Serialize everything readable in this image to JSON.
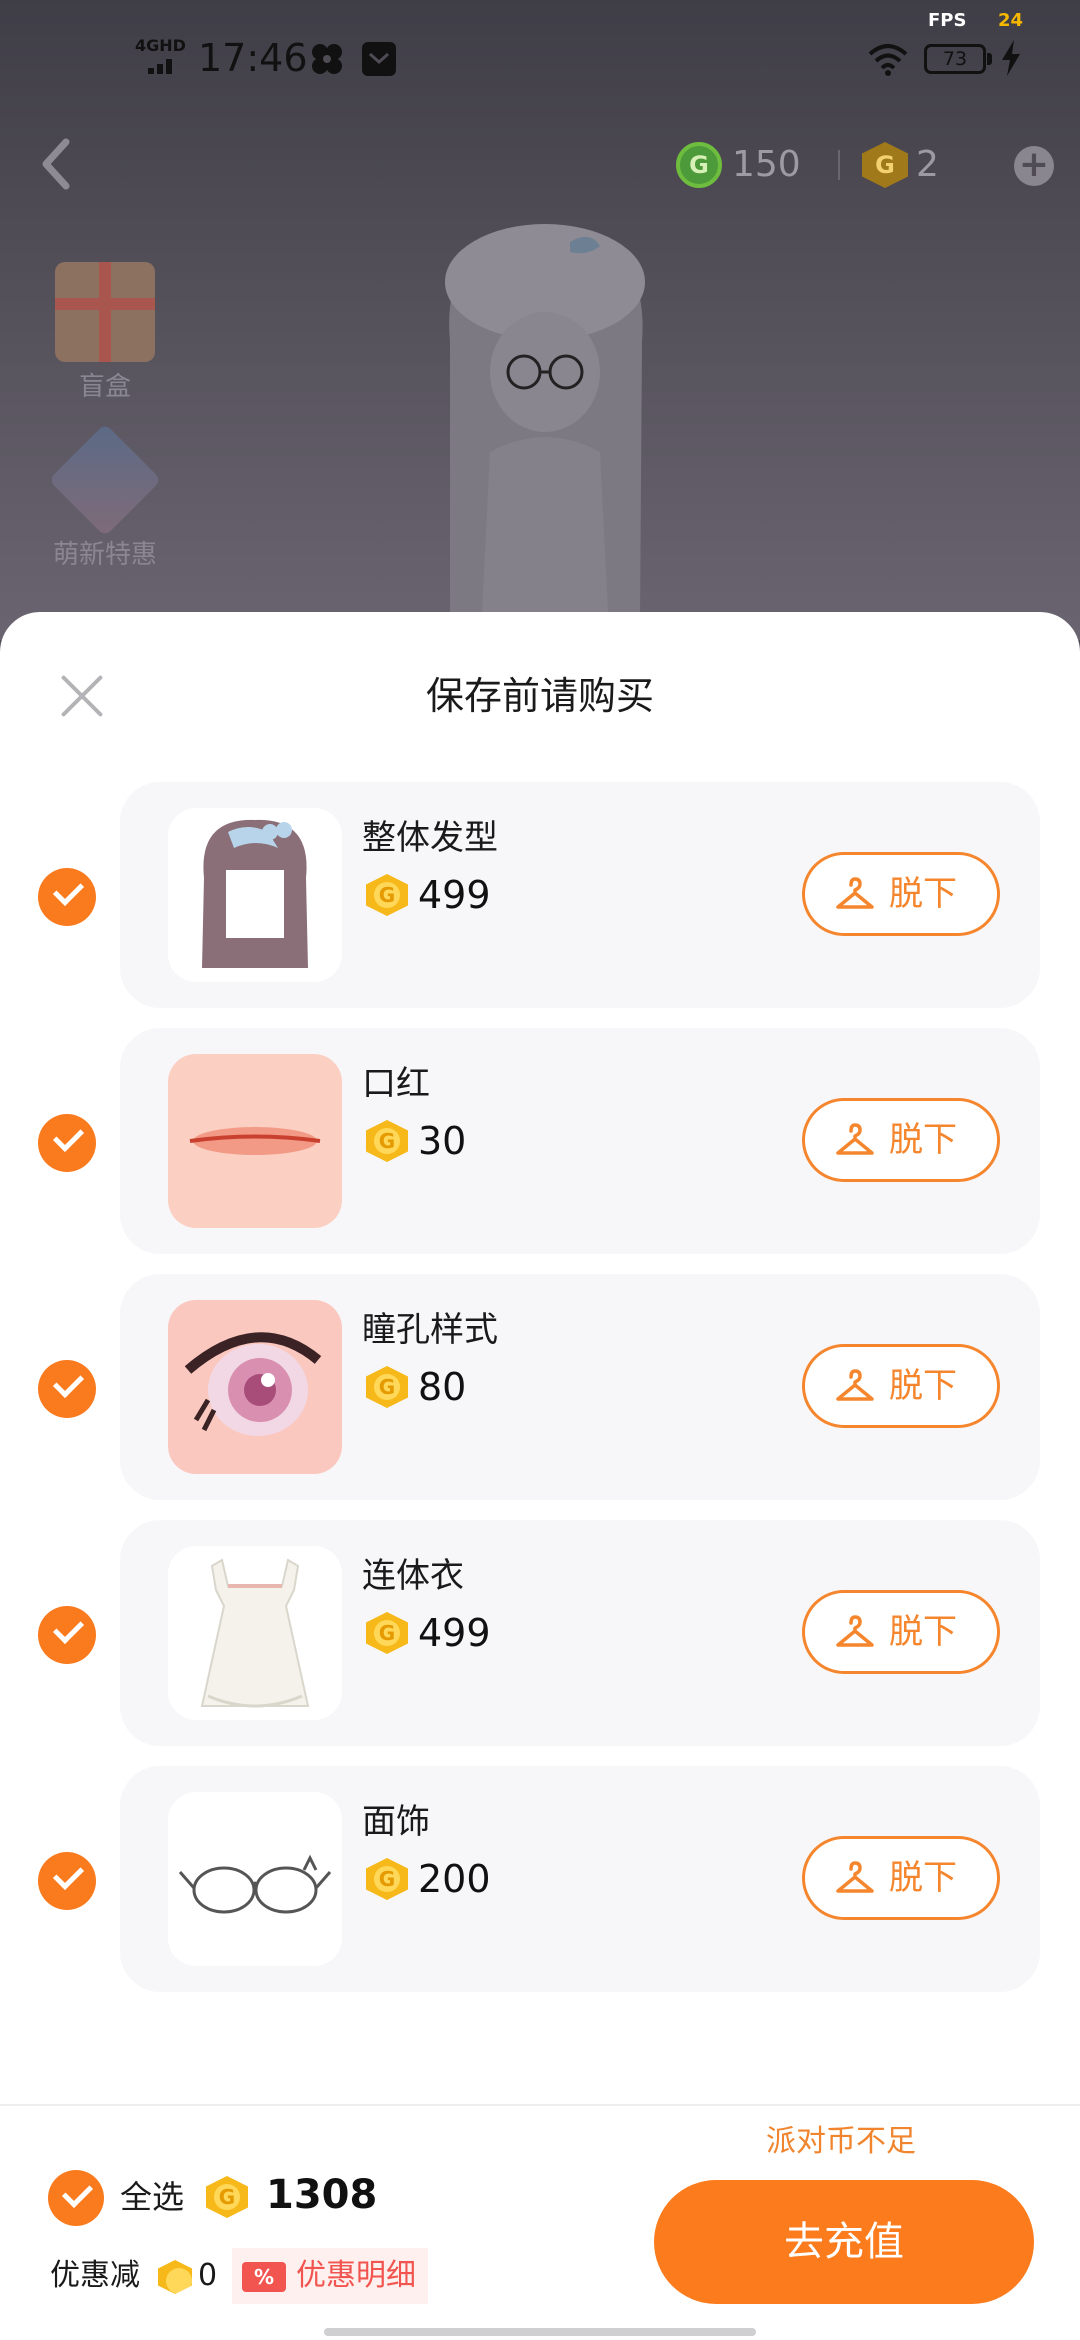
{
  "status_bar": {
    "network": "4GHD",
    "time": "17:46",
    "fps_label": "FPS",
    "fps_value": "24",
    "battery": "73"
  },
  "topbar": {
    "green_currency_value": "150",
    "gold_currency_value": "2"
  },
  "side_entries": [
    {
      "label": "盲盒",
      "icon": "gift-box-icon"
    },
    {
      "label": "萌新特惠",
      "icon": "promo-icon"
    }
  ],
  "sheet": {
    "title": "保存前请购买",
    "items": [
      {
        "name": "整体发型",
        "price": "499",
        "remove_label": "脱下",
        "selected": true
      },
      {
        "name": "口红",
        "price": "30",
        "remove_label": "脱下",
        "selected": true
      },
      {
        "name": "瞳孔样式",
        "price": "80",
        "remove_label": "脱下",
        "selected": true
      },
      {
        "name": "连体衣",
        "price": "499",
        "remove_label": "脱下",
        "selected": true
      },
      {
        "name": "面饰",
        "price": "200",
        "remove_label": "脱下",
        "selected": true
      }
    ]
  },
  "footer": {
    "select_all_label": "全选",
    "total": "1308",
    "discount_label": "优惠减",
    "discount_value": "0",
    "discount_detail_badge": "%",
    "discount_detail_label": "优惠明细",
    "insufficient_notice": "派对币不足",
    "recharge_label": "去充值"
  },
  "colors": {
    "accent_orange": "#fb7b1d",
    "coin_gold": "#f6b919",
    "discount_red": "#f2554f"
  }
}
